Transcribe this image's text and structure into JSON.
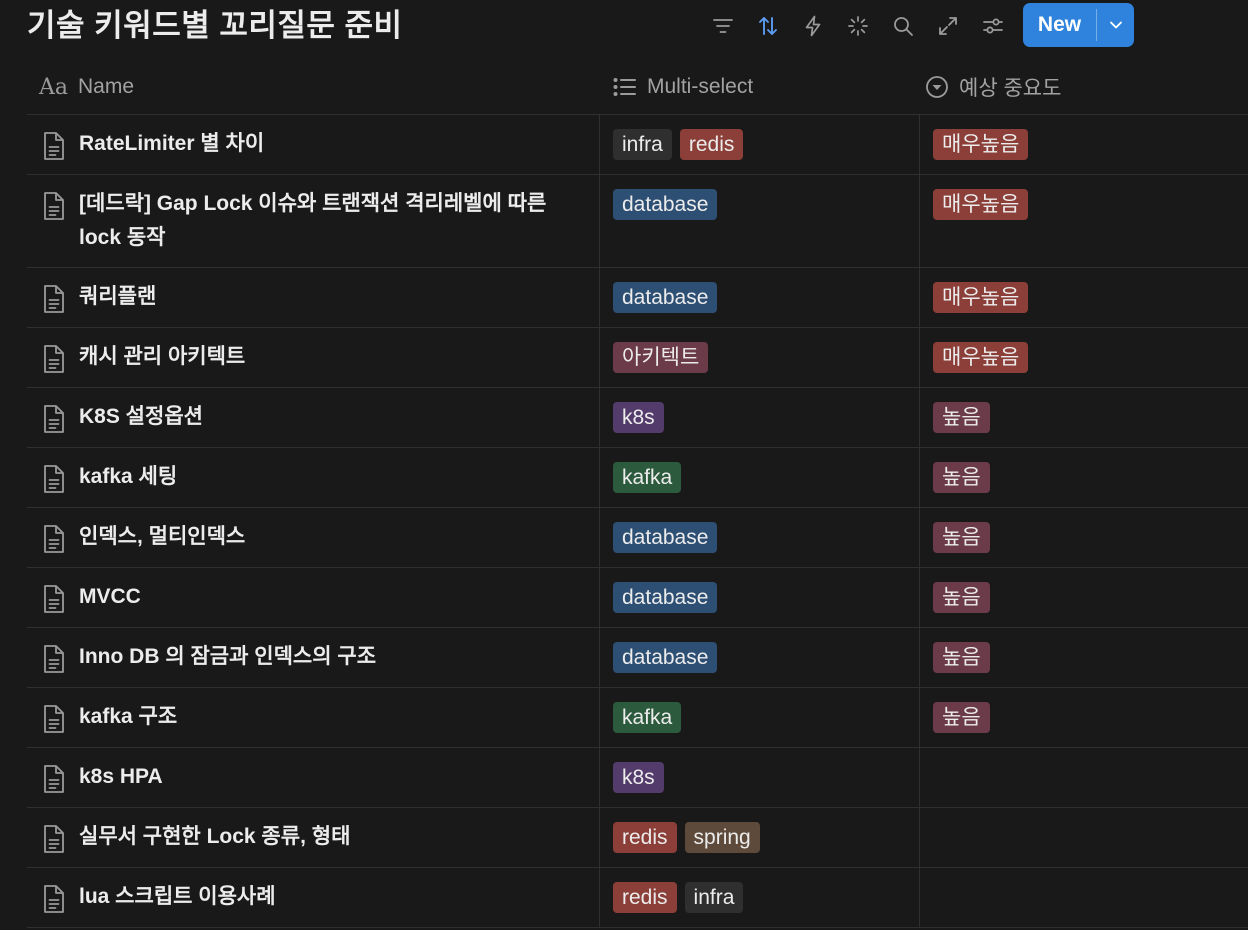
{
  "page": {
    "title": "기술 키워드별 꼬리질문 준비"
  },
  "toolbar": {
    "icons": [
      "filter-icon",
      "sort-icon",
      "lightning-icon",
      "sparkle-icon",
      "search-icon",
      "expand-icon",
      "settings-sliders-icon"
    ],
    "accent": "#5b9bf0",
    "new_label": "New"
  },
  "columns": {
    "name": "Name",
    "name_icon": "Aa",
    "multiselect": "Multi-select",
    "importance": "예상 중요도"
  },
  "tag_colors": {
    "infra": "#2f2f2f",
    "redis": "#8b3f38",
    "database": "#2d4f74",
    "아키텍트": "#6c3b4a",
    "k8s": "#533b6b",
    "kafka": "#2c5a3d",
    "spring": "#5e4a3a",
    "매우높음": "#8b3f38",
    "높음": "#6c3b4a"
  },
  "rows": [
    {
      "title": "RateLimiter 별 차이",
      "tags": [
        "infra",
        "redis"
      ],
      "importance": "매우높음"
    },
    {
      "title": "[데드락] Gap Lock 이슈와 트랜잭션 격리레벨에 따른 lock 동작",
      "tags": [
        "database"
      ],
      "importance": "매우높음"
    },
    {
      "title": "쿼리플랜",
      "tags": [
        "database"
      ],
      "importance": "매우높음"
    },
    {
      "title": "캐시 관리 아키텍트",
      "tags": [
        "아키텍트"
      ],
      "importance": "매우높음"
    },
    {
      "title": "K8S 설정옵션",
      "tags": [
        "k8s"
      ],
      "importance": "높음"
    },
    {
      "title": "kafka 세팅",
      "tags": [
        "kafka"
      ],
      "importance": "높음"
    },
    {
      "title": "인덱스, 멀티인덱스",
      "tags": [
        "database"
      ],
      "importance": "높음"
    },
    {
      "title": "MVCC",
      "tags": [
        "database"
      ],
      "importance": "높음"
    },
    {
      "title": "Inno DB 의 잠금과 인덱스의 구조",
      "tags": [
        "database"
      ],
      "importance": "높음"
    },
    {
      "title": "kafka 구조",
      "tags": [
        "kafka"
      ],
      "importance": "높음"
    },
    {
      "title": "k8s HPA",
      "tags": [
        "k8s"
      ],
      "importance": ""
    },
    {
      "title": "실무서 구현한 Lock 종류, 형태",
      "tags": [
        "redis",
        "spring"
      ],
      "importance": ""
    },
    {
      "title": "lua 스크립트 이용사례",
      "tags": [
        "redis",
        "infra"
      ],
      "importance": ""
    }
  ]
}
